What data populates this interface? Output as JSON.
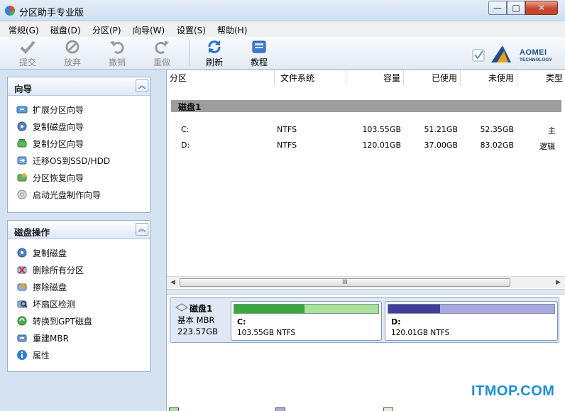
{
  "window": {
    "title": "分区助手专业版",
    "min_glyph": "—",
    "max_glyph": "□",
    "close_glyph": "✕"
  },
  "menu": [
    "常规(G)",
    "磁盘(D)",
    "分区(P)",
    "向导(W)",
    "设置(S)",
    "帮助(H)"
  ],
  "toolbar": {
    "submit": "提交",
    "discard": "放弃",
    "undo": "撤销",
    "redo": "重做",
    "refresh": "刷新",
    "tutorial": "教程"
  },
  "logo": {
    "name": "AOMEI",
    "sub": "TECHNOLOGY"
  },
  "wizard_panel": {
    "title": "向导",
    "items": [
      "扩展分区向导",
      "复制磁盘向导",
      "复制分区向导",
      "迁移OS到SSD/HDD",
      "分区恢复向导",
      "启动光盘制作向导"
    ]
  },
  "disk_panel": {
    "title": "磁盘操作",
    "items": [
      "复制磁盘",
      "删除所有分区",
      "擦除磁盘",
      "坏扇区检测",
      "转换到GPT磁盘",
      "重建MBR",
      "属性"
    ]
  },
  "columns": [
    "分区",
    "文件系统",
    "容量",
    "已使用",
    "未使用",
    "类型"
  ],
  "disk_list": {
    "group_label": "磁盘1",
    "rows": [
      {
        "partition": "C:",
        "fs": "NTFS",
        "capacity": "103.55GB",
        "used": "51.21GB",
        "free": "52.35GB",
        "type": "主"
      },
      {
        "partition": "D:",
        "fs": "NTFS",
        "capacity": "120.01GB",
        "used": "37.00GB",
        "free": "83.02GB",
        "type": "逻辑"
      }
    ]
  },
  "disk_map": {
    "name": "磁盘1",
    "type": "基本 MBR",
    "size": "223.57GB",
    "partitions": [
      {
        "letter": "C:",
        "desc": "103.55GB NTFS",
        "used_fraction": 0.49,
        "used_color": "#3aa83a",
        "free_color": "#a9e29a"
      },
      {
        "letter": "D:",
        "desc": "120.01GB NTFS",
        "used_fraction": 0.31,
        "used_color": "#3f3f9a",
        "free_color": "#a9a9e0"
      }
    ]
  },
  "watermark": "ITMOP.COM",
  "hscroll_grip": "III"
}
